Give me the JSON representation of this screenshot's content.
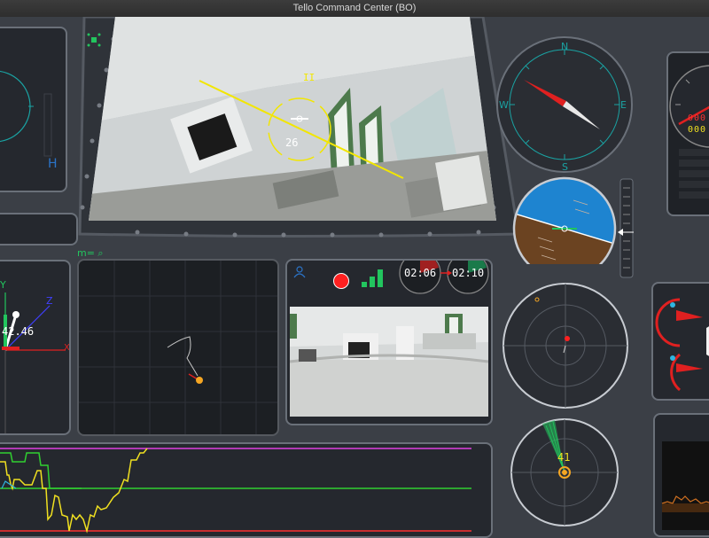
{
  "window": {
    "title": "Tello Command Center (BO)"
  },
  "hud": {
    "pitch_value": "26",
    "top_mark": "II"
  },
  "compass": {
    "north": "N",
    "south": "S",
    "east": "E",
    "west": "W"
  },
  "left_gauge": {
    "label": "H"
  },
  "axis3d": {
    "x_label": "X",
    "y_label": "Y",
    "z_label": "Z",
    "value": "42.46"
  },
  "map": {
    "header": "m= ⌕"
  },
  "camera_panel": {
    "timer_1": "02:06",
    "timer_2": "02:10",
    "signal_bars": 3
  },
  "altimeter": {
    "digits_top": "000",
    "digits_bottom": "000"
  },
  "radar": {
    "value": "41"
  },
  "colors": {
    "accent_green": "#22c55e",
    "compass_teal": "#1aa3a3",
    "sky": "#1e84d0",
    "ground": "#6b4321",
    "record": "#ff2020",
    "graph_magenta": "#e040e0",
    "graph_yellow": "#f0e020",
    "graph_green": "#30d030",
    "graph_red": "#ff3030"
  }
}
